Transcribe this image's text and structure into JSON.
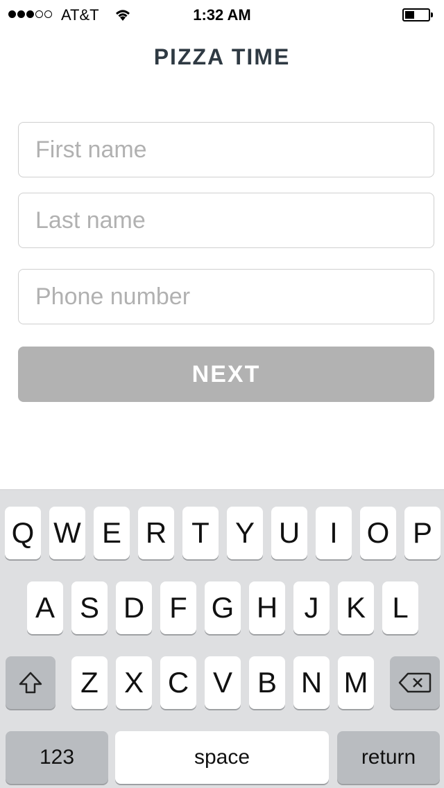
{
  "status_bar": {
    "carrier": "AT&T",
    "time": "1:32 AM",
    "signal_bars_filled": 3,
    "signal_bars_total": 5,
    "battery_level": 0.4
  },
  "app": {
    "title": "PIZZA TIME"
  },
  "form": {
    "first_name_placeholder": "First name",
    "last_name_placeholder": "Last name",
    "phone_placeholder": "Phone number",
    "next_label": "NEXT"
  },
  "keyboard": {
    "row1": [
      "Q",
      "W",
      "E",
      "R",
      "T",
      "Y",
      "U",
      "I",
      "O",
      "P"
    ],
    "row2": [
      "A",
      "S",
      "D",
      "F",
      "G",
      "H",
      "J",
      "K",
      "L"
    ],
    "row3": [
      "Z",
      "X",
      "C",
      "V",
      "B",
      "N",
      "M"
    ],
    "numbers_label": "123",
    "space_label": "space",
    "return_label": "return"
  },
  "colors": {
    "button_disabled": "#b2b2b2",
    "keyboard_bg": "#dedfe1",
    "title": "#2f3a43"
  }
}
